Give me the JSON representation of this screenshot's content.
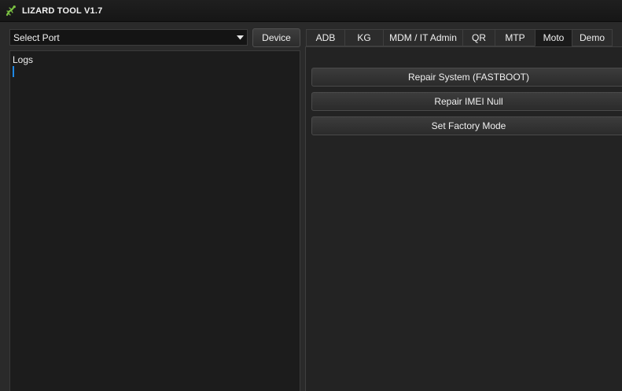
{
  "window": {
    "title": "LIZARD TOOL V1.7",
    "icon": "lizard-icon",
    "accent_color": "#7ac142"
  },
  "port": {
    "selected": "Select Port"
  },
  "device_button": {
    "label": "Device"
  },
  "logs": {
    "title": "Logs",
    "caret_color": "#1e88e5"
  },
  "tabs": [
    {
      "label": "ADB",
      "active": false
    },
    {
      "label": "KG",
      "active": false
    },
    {
      "label": "MDM / IT Admin",
      "active": false
    },
    {
      "label": "QR",
      "active": false
    },
    {
      "label": "MTP",
      "active": false
    },
    {
      "label": "Moto",
      "active": true
    },
    {
      "label": "Demo",
      "active": false
    }
  ],
  "moto": {
    "actions": [
      {
        "label": "Repair System (FASTBOOT)"
      },
      {
        "label": "Repair IMEI Null"
      },
      {
        "label": "Set Factory Mode"
      }
    ]
  }
}
